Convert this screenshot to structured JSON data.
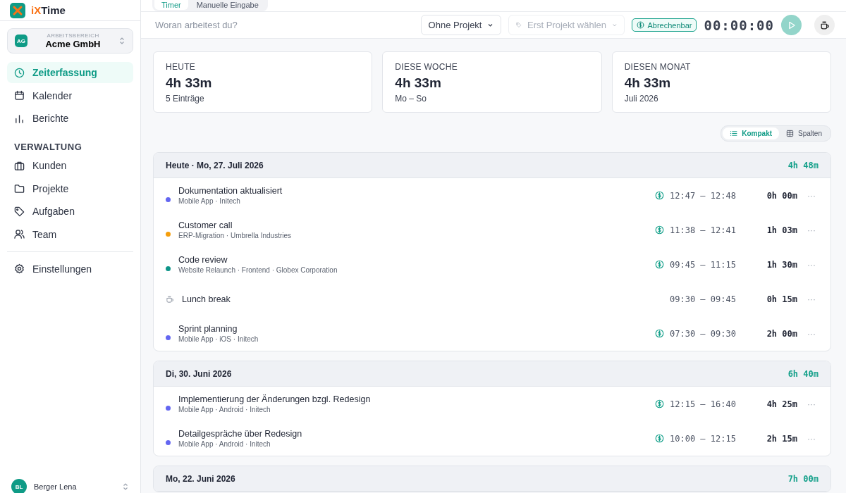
{
  "app": {
    "name_prefix": "iX",
    "name_rest": "Time"
  },
  "workspace": {
    "initials": "AG",
    "label": "ARBEITSBEREICH",
    "name": "Acme GmbH"
  },
  "nav": [
    {
      "label": "Zeiterfassung",
      "selected": true
    },
    {
      "label": "Kalender",
      "selected": false
    },
    {
      "label": "Berichte",
      "selected": false
    }
  ],
  "admin": {
    "heading": "VERWALTUNG",
    "items": [
      {
        "label": "Kunden",
        "selected": false
      },
      {
        "label": "Projekte",
        "selected": false
      },
      {
        "label": "Aufgaben",
        "selected": false
      },
      {
        "label": "Team",
        "selected": false
      }
    ]
  },
  "settings": {
    "label": "Einstellungen",
    "selected": false
  },
  "user": {
    "initials": "BL",
    "name": "Berger Lena"
  },
  "mode_tabs": [
    {
      "label": "Timer",
      "selected": true
    },
    {
      "label": "Manuelle Eingabe",
      "selected": false
    }
  ],
  "timer": {
    "placeholder": "Woran arbeitest du?",
    "project": "Ohne Projekt",
    "task_placeholder": "Erst Projekt wählen",
    "billable_label": "Abrechenbar",
    "billable": true,
    "time": "00:00:00"
  },
  "stats": [
    {
      "label": "HEUTE",
      "value": "4h 33m",
      "sub": "5 Einträge"
    },
    {
      "label": "DIESE WOCHE",
      "value": "4h 33m",
      "sub": "Mo – So"
    },
    {
      "label": "DIESEN MONAT",
      "value": "4h 33m",
      "sub": "Juli 2026"
    }
  ],
  "view_toggle": [
    {
      "label": "Kompakt",
      "selected": true
    },
    {
      "label": "Spalten",
      "selected": false
    }
  ],
  "days": [
    {
      "title": "Heute · Mo, 27. Juli 2026",
      "total": "4h 48m",
      "entries": [
        {
          "kind": "task",
          "title": "Dokumentation aktualisiert",
          "meta": "Mobile App · Initech",
          "color": "#6366f1",
          "billable": true,
          "range": "12:47 – 12:48",
          "duration": "0h 00m",
          "menu": "···"
        },
        {
          "kind": "task",
          "title": "Customer call",
          "meta": "ERP-Migration · Umbrella Industries",
          "color": "#f59e0b",
          "billable": true,
          "range": "11:38 – 12:41",
          "duration": "1h 03m",
          "menu": "···"
        },
        {
          "kind": "task",
          "title": "Code review",
          "meta": "Website Relaunch · Frontend · Globex Corporation",
          "color": "#0d9488",
          "billable": true,
          "range": "09:45 – 11:15",
          "duration": "1h 30m",
          "menu": "···"
        },
        {
          "kind": "break",
          "title": "Lunch break",
          "billable": false,
          "range": "09:30 – 09:45",
          "duration": "0h 15m",
          "menu": "···"
        },
        {
          "kind": "task",
          "title": "Sprint planning",
          "meta": "Mobile App · iOS · Initech",
          "color": "#6366f1",
          "billable": true,
          "range": "07:30 – 09:30",
          "duration": "2h 00m",
          "menu": "···"
        }
      ]
    },
    {
      "title": "Di, 30. Juni 2026",
      "total": "6h 40m",
      "entries": [
        {
          "kind": "task",
          "title": "Implementierung der Änderungen bzgl. Redesign",
          "meta": "Mobile App · Android · Initech",
          "color": "#6366f1",
          "billable": true,
          "range": "12:15 – 16:40",
          "duration": "4h 25m",
          "menu": "···"
        },
        {
          "kind": "task",
          "title": "Detailgespräche über Redesign",
          "meta": "Mobile App · Android · Initech",
          "color": "#6366f1",
          "billable": true,
          "range": "10:00 – 12:15",
          "duration": "2h 15m",
          "menu": "···"
        }
      ]
    },
    {
      "title": "Mo, 22. Juni 2026",
      "total": "7h 00m"
    }
  ]
}
